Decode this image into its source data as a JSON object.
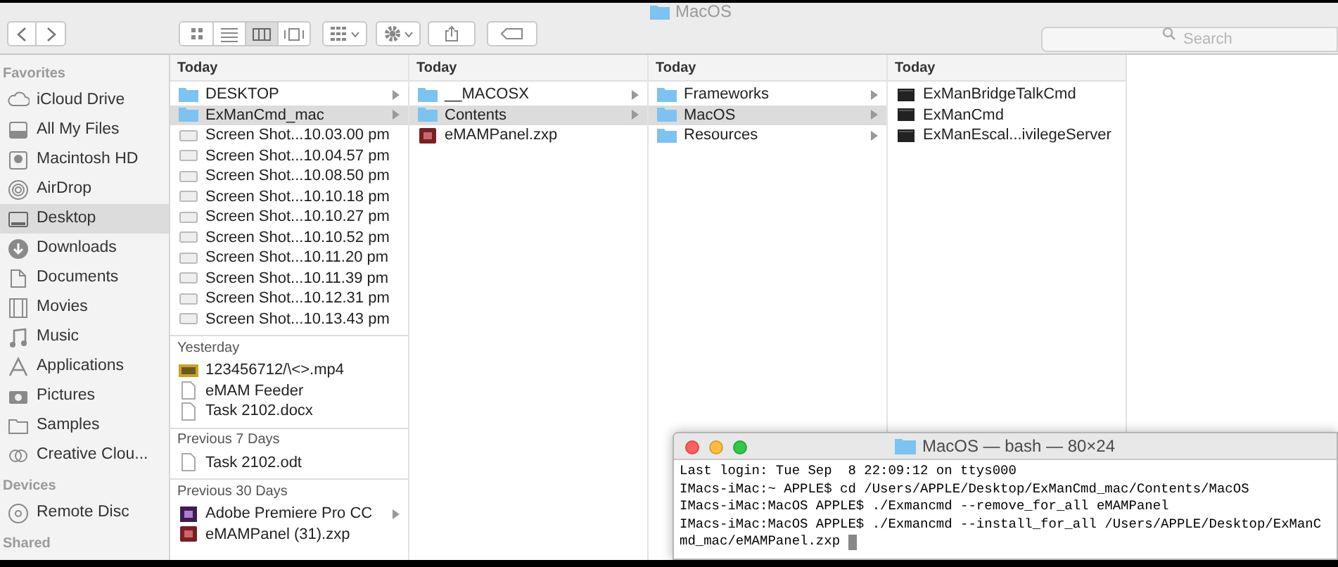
{
  "window": {
    "title": "MacOS"
  },
  "toolbar": {
    "view_buttons": [
      {
        "kind": "icons",
        "selected": false
      },
      {
        "kind": "list",
        "selected": false
      },
      {
        "kind": "columns",
        "selected": true
      },
      {
        "kind": "coverflow",
        "selected": false
      }
    ],
    "search": {
      "placeholder": "Search"
    }
  },
  "sidebar": [
    {
      "heading": "Favorites",
      "items": [
        {
          "label": "iCloud Drive",
          "kind": "cloud",
          "selected": false
        },
        {
          "label": "All My Files",
          "kind": "files",
          "selected": false
        },
        {
          "label": "Macintosh HD",
          "kind": "disk",
          "selected": false
        },
        {
          "label": "AirDrop",
          "kind": "airdrop",
          "selected": false
        },
        {
          "label": "Desktop",
          "kind": "desktop",
          "selected": true
        },
        {
          "label": "Downloads",
          "kind": "download",
          "selected": false
        },
        {
          "label": "Documents",
          "kind": "documents",
          "selected": false
        },
        {
          "label": "Movies",
          "kind": "movies",
          "selected": false
        },
        {
          "label": "Music",
          "kind": "music",
          "selected": false
        },
        {
          "label": "Applications",
          "kind": "apps",
          "selected": false
        },
        {
          "label": "Pictures",
          "kind": "camera",
          "selected": false
        },
        {
          "label": "Samples",
          "kind": "folder",
          "selected": false
        },
        {
          "label": "Creative Clou...",
          "kind": "creative",
          "selected": false
        }
      ]
    },
    {
      "heading": "Devices",
      "items": [
        {
          "label": "Remote Disc",
          "kind": "disc",
          "selected": false
        }
      ]
    },
    {
      "heading": "Shared"
    }
  ],
  "columns": [
    {
      "groups": [
        {
          "heading": "Today",
          "items": [
            {
              "label": "DESKTOP",
              "kind": "folder",
              "selected": false,
              "has_children": true
            },
            {
              "label": "ExManCmd_mac",
              "kind": "folder",
              "selected": true,
              "has_children": true
            },
            {
              "label": "Screen Shot...10.03.00 pm",
              "kind": "image",
              "selected": false,
              "has_children": false
            },
            {
              "label": "Screen Shot...10.04.57 pm",
              "kind": "image",
              "selected": false,
              "has_children": false
            },
            {
              "label": "Screen Shot...10.08.50 pm",
              "kind": "image",
              "selected": false,
              "has_children": false
            },
            {
              "label": "Screen Shot...10.10.18 pm",
              "kind": "image",
              "selected": false,
              "has_children": false
            },
            {
              "label": "Screen Shot...10.10.27 pm",
              "kind": "image",
              "selected": false,
              "has_children": false
            },
            {
              "label": "Screen Shot...10.10.52 pm",
              "kind": "image",
              "selected": false,
              "has_children": false
            },
            {
              "label": "Screen Shot...10.11.20 pm",
              "kind": "image",
              "selected": false,
              "has_children": false
            },
            {
              "label": "Screen Shot...10.11.39 pm",
              "kind": "image",
              "selected": false,
              "has_children": false
            },
            {
              "label": "Screen Shot...10.12.31 pm",
              "kind": "image",
              "selected": false,
              "has_children": false
            },
            {
              "label": "Screen Shot...10.13.43 pm",
              "kind": "image",
              "selected": false,
              "has_children": false
            }
          ]
        },
        {
          "heading": "Yesterday",
          "items": [
            {
              "label": "123456712/\\<>.mp4",
              "kind": "video",
              "selected": false,
              "has_children": false
            },
            {
              "label": "eMAM Feeder",
              "kind": "document",
              "selected": false,
              "has_children": false
            },
            {
              "label": "Task 2102.docx",
              "kind": "document",
              "selected": false,
              "has_children": false
            }
          ]
        },
        {
          "heading": "Previous 7 Days",
          "items": [
            {
              "label": "Task 2102.odt",
              "kind": "document",
              "selected": false,
              "has_children": false
            }
          ]
        },
        {
          "heading": "Previous 30 Days",
          "items": [
            {
              "label": "Adobe Premiere Pro CC",
              "kind": "app",
              "selected": false,
              "has_children": true
            },
            {
              "label": "eMAMPanel (31).zxp",
              "kind": "package",
              "selected": false,
              "has_children": false
            }
          ]
        }
      ]
    },
    {
      "groups": [
        {
          "heading": "Today",
          "items": [
            {
              "label": "__MACOSX",
              "kind": "folder",
              "selected": false,
              "has_children": true
            },
            {
              "label": "Contents",
              "kind": "folder",
              "selected": true,
              "has_children": true
            },
            {
              "label": "eMAMPanel.zxp",
              "kind": "package",
              "selected": false,
              "has_children": false
            }
          ]
        }
      ]
    },
    {
      "groups": [
        {
          "heading": "Today",
          "items": [
            {
              "label": "Frameworks",
              "kind": "folder",
              "selected": false,
              "has_children": true
            },
            {
              "label": "MacOS",
              "kind": "folder",
              "selected": true,
              "has_children": true
            },
            {
              "label": "Resources",
              "kind": "folder",
              "selected": false,
              "has_children": true
            }
          ]
        }
      ]
    },
    {
      "groups": [
        {
          "heading": "Today",
          "items": [
            {
              "label": "ExManBridgeTalkCmd",
              "kind": "executable",
              "selected": false,
              "has_children": false
            },
            {
              "label": "ExManCmd",
              "kind": "executable",
              "selected": false,
              "has_children": false
            },
            {
              "label": "ExManEscal...ivilegeServer",
              "kind": "executable",
              "selected": false,
              "has_children": false
            }
          ]
        }
      ]
    }
  ],
  "terminal": {
    "title": "MacOS — bash — 80×24",
    "cursor": true,
    "lines": [
      "Last login: Tue Sep  8 22:09:12 on ttys000",
      "IMacs-iMac:~ APPLE$ cd /Users/APPLE/Desktop/ExManCmd_mac/Contents/MacOS",
      "IMacs-iMac:MacOS APPLE$ ./Exmancmd --remove_for_all eMAMPanel",
      "IMacs-iMac:MacOS APPLE$ ./Exmancmd --install_for_all /Users/APPLE/Desktop/ExManC",
      "md_mac/eMAMPanel.zxp"
    ]
  }
}
